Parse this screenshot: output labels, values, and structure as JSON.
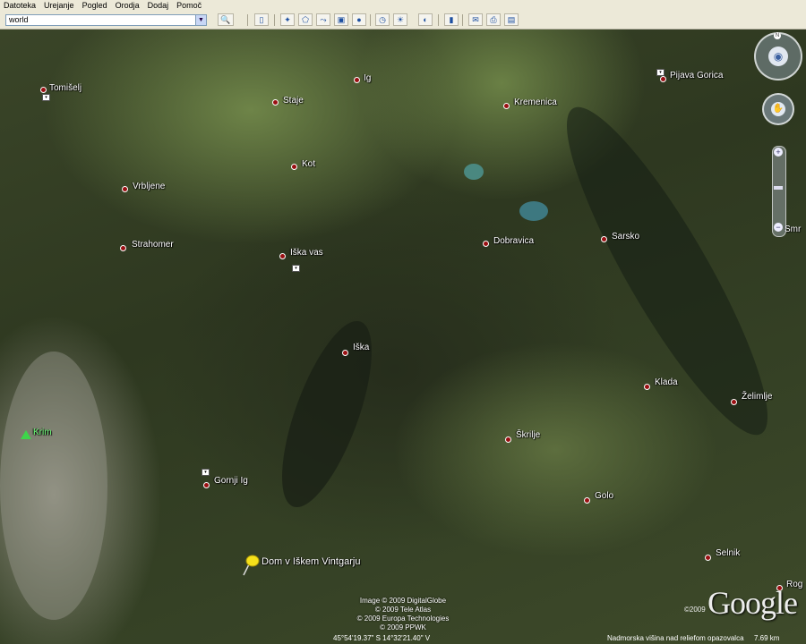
{
  "menu": [
    "Datoteka",
    "Urejanje",
    "Pogled",
    "Orodja",
    "Dodaj",
    "Pomoč"
  ],
  "search": {
    "value": "world"
  },
  "toolbar_icons": [
    "search-button-icon",
    "sidebar-icon",
    "placemark-icon",
    "polygon-icon",
    "path-icon",
    "image-overlay-icon",
    "tour-icon",
    "historical-imagery-icon",
    "sunlight-icon",
    "planets-icon",
    "ruler-icon",
    "email-icon",
    "print-icon",
    "maps-icon"
  ],
  "places": [
    {
      "name": "Tomišelj"
    },
    {
      "name": "Staje"
    },
    {
      "name": "Ig"
    },
    {
      "name": "Kremenica"
    },
    {
      "name": "Pijava Gorica"
    },
    {
      "name": "Kot"
    },
    {
      "name": "Vrbljene"
    },
    {
      "name": "Strahomer"
    },
    {
      "name": "Iška vas"
    },
    {
      "name": "Dobravica"
    },
    {
      "name": "Sarsko"
    },
    {
      "name": "Smr"
    },
    {
      "name": "Iška"
    },
    {
      "name": "Klada"
    },
    {
      "name": "Želimlje"
    },
    {
      "name": "Škrilje"
    },
    {
      "name": "Gornji Ig"
    },
    {
      "name": "Golo"
    },
    {
      "name": "Selnik"
    },
    {
      "name": "Rog"
    }
  ],
  "peak": {
    "name": "Krim"
  },
  "placemark": {
    "name": "Dom v Iškem Vintgarju"
  },
  "credits": [
    "Image © 2009 DigitalGlobe",
    "© 2009 Tele Atlas",
    "© 2009 Europa Technologies",
    "© 2009 PPWK"
  ],
  "google": {
    "year": "©2009",
    "logo": "Google"
  },
  "status": {
    "coords": "45°54'19.37\" S      14°32'21.40\" V",
    "elevation_label": "Nadmorska višina nad reliefom opazovalca",
    "elevation": "7.69 km"
  }
}
